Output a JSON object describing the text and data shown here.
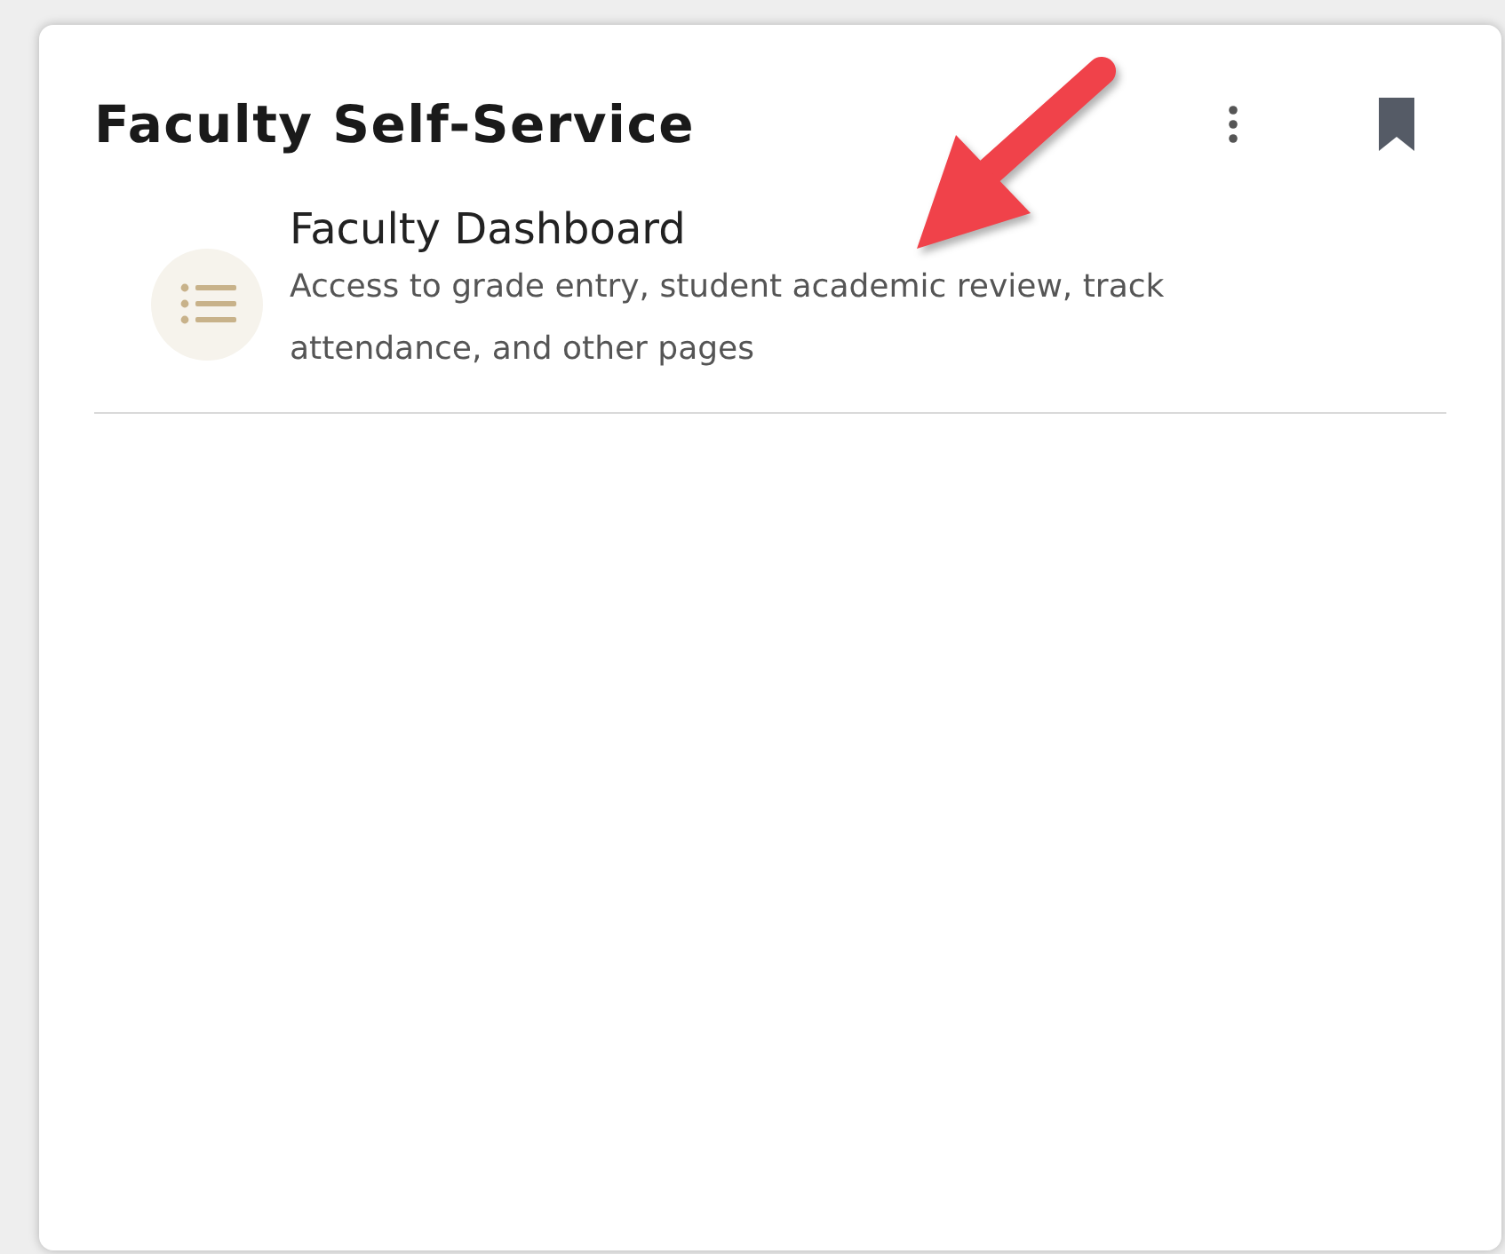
{
  "card": {
    "title": "Faculty Self-Service",
    "items": [
      {
        "title": "Faculty Dashboard",
        "description": "Access to grade entry, student academic review, track attendance, and other pages"
      }
    ]
  }
}
